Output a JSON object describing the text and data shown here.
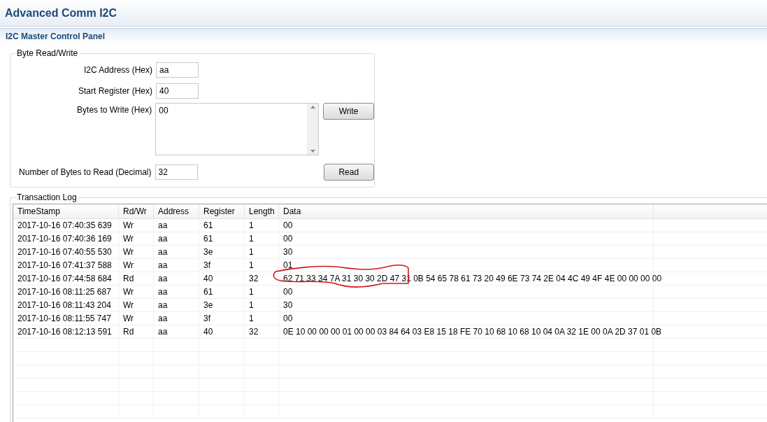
{
  "window": {
    "title": "Advanced Comm I2C"
  },
  "panel": {
    "title": "I2C Master Control Panel"
  },
  "byte_read_write": {
    "title": "Byte Read/Write",
    "i2c_address": {
      "label": "I2C Address (Hex)",
      "value": "aa"
    },
    "start_register": {
      "label": "Start Register (Hex)",
      "value": "40"
    },
    "bytes_to_write": {
      "label": "Bytes to Write (Hex)",
      "value": "00"
    },
    "write_button": "Write",
    "bytes_to_read": {
      "label": "Number of Bytes to Read (Decimal)",
      "value": "32"
    },
    "read_button": "Read"
  },
  "transaction_log": {
    "title": "Transaction Log",
    "columns": [
      "TimeStamp",
      "Rd/Wr",
      "Address",
      "Register",
      "Length",
      "Data"
    ],
    "rows": [
      {
        "cells": [
          "2017-10-16 07:40:35 639",
          "Wr",
          "aa",
          "61",
          "1",
          "00"
        ],
        "annotated": false
      },
      {
        "cells": [
          "2017-10-16 07:40:36 169",
          "Wr",
          "aa",
          "61",
          "1",
          "00"
        ],
        "annotated": false
      },
      {
        "cells": [
          "2017-10-16 07:40:55 530",
          "Wr",
          "aa",
          "3e",
          "1",
          "30"
        ],
        "annotated": false
      },
      {
        "cells": [
          "2017-10-16 07:41:37 588",
          "Wr",
          "aa",
          "3f",
          "1",
          "01"
        ],
        "annotated": false
      },
      {
        "cells": [
          "2017-10-16 07:44:58 684",
          "Rd",
          "aa",
          "40",
          "32",
          "62 71 33 34 7A 31 30 30 2D 47 31 0B 54 65 78 61 73 20 49 6E 73 74 2E 04 4C 49 4F 4E 00 00 00 00"
        ],
        "annotated": true
      },
      {
        "cells": [
          "2017-10-16 08:11:25 687",
          "Wr",
          "aa",
          "61",
          "1",
          "00"
        ],
        "annotated": false
      },
      {
        "cells": [
          "2017-10-16 08:11:43 204",
          "Wr",
          "aa",
          "3e",
          "1",
          "30"
        ],
        "annotated": false
      },
      {
        "cells": [
          "2017-10-16 08:11:55 747",
          "Wr",
          "aa",
          "3f",
          "1",
          "00"
        ],
        "annotated": false
      },
      {
        "cells": [
          "2017-10-16 08:12:13 591",
          "Rd",
          "aa",
          "40",
          "32",
          "0E 10 00 00 00 01 00 00 03 84 64 03 E8 15 18 FE 70 10 68 10 68 10 04 0A 32 1E 00 0A 2D 37 01 0B"
        ],
        "annotated": false
      }
    ]
  }
}
